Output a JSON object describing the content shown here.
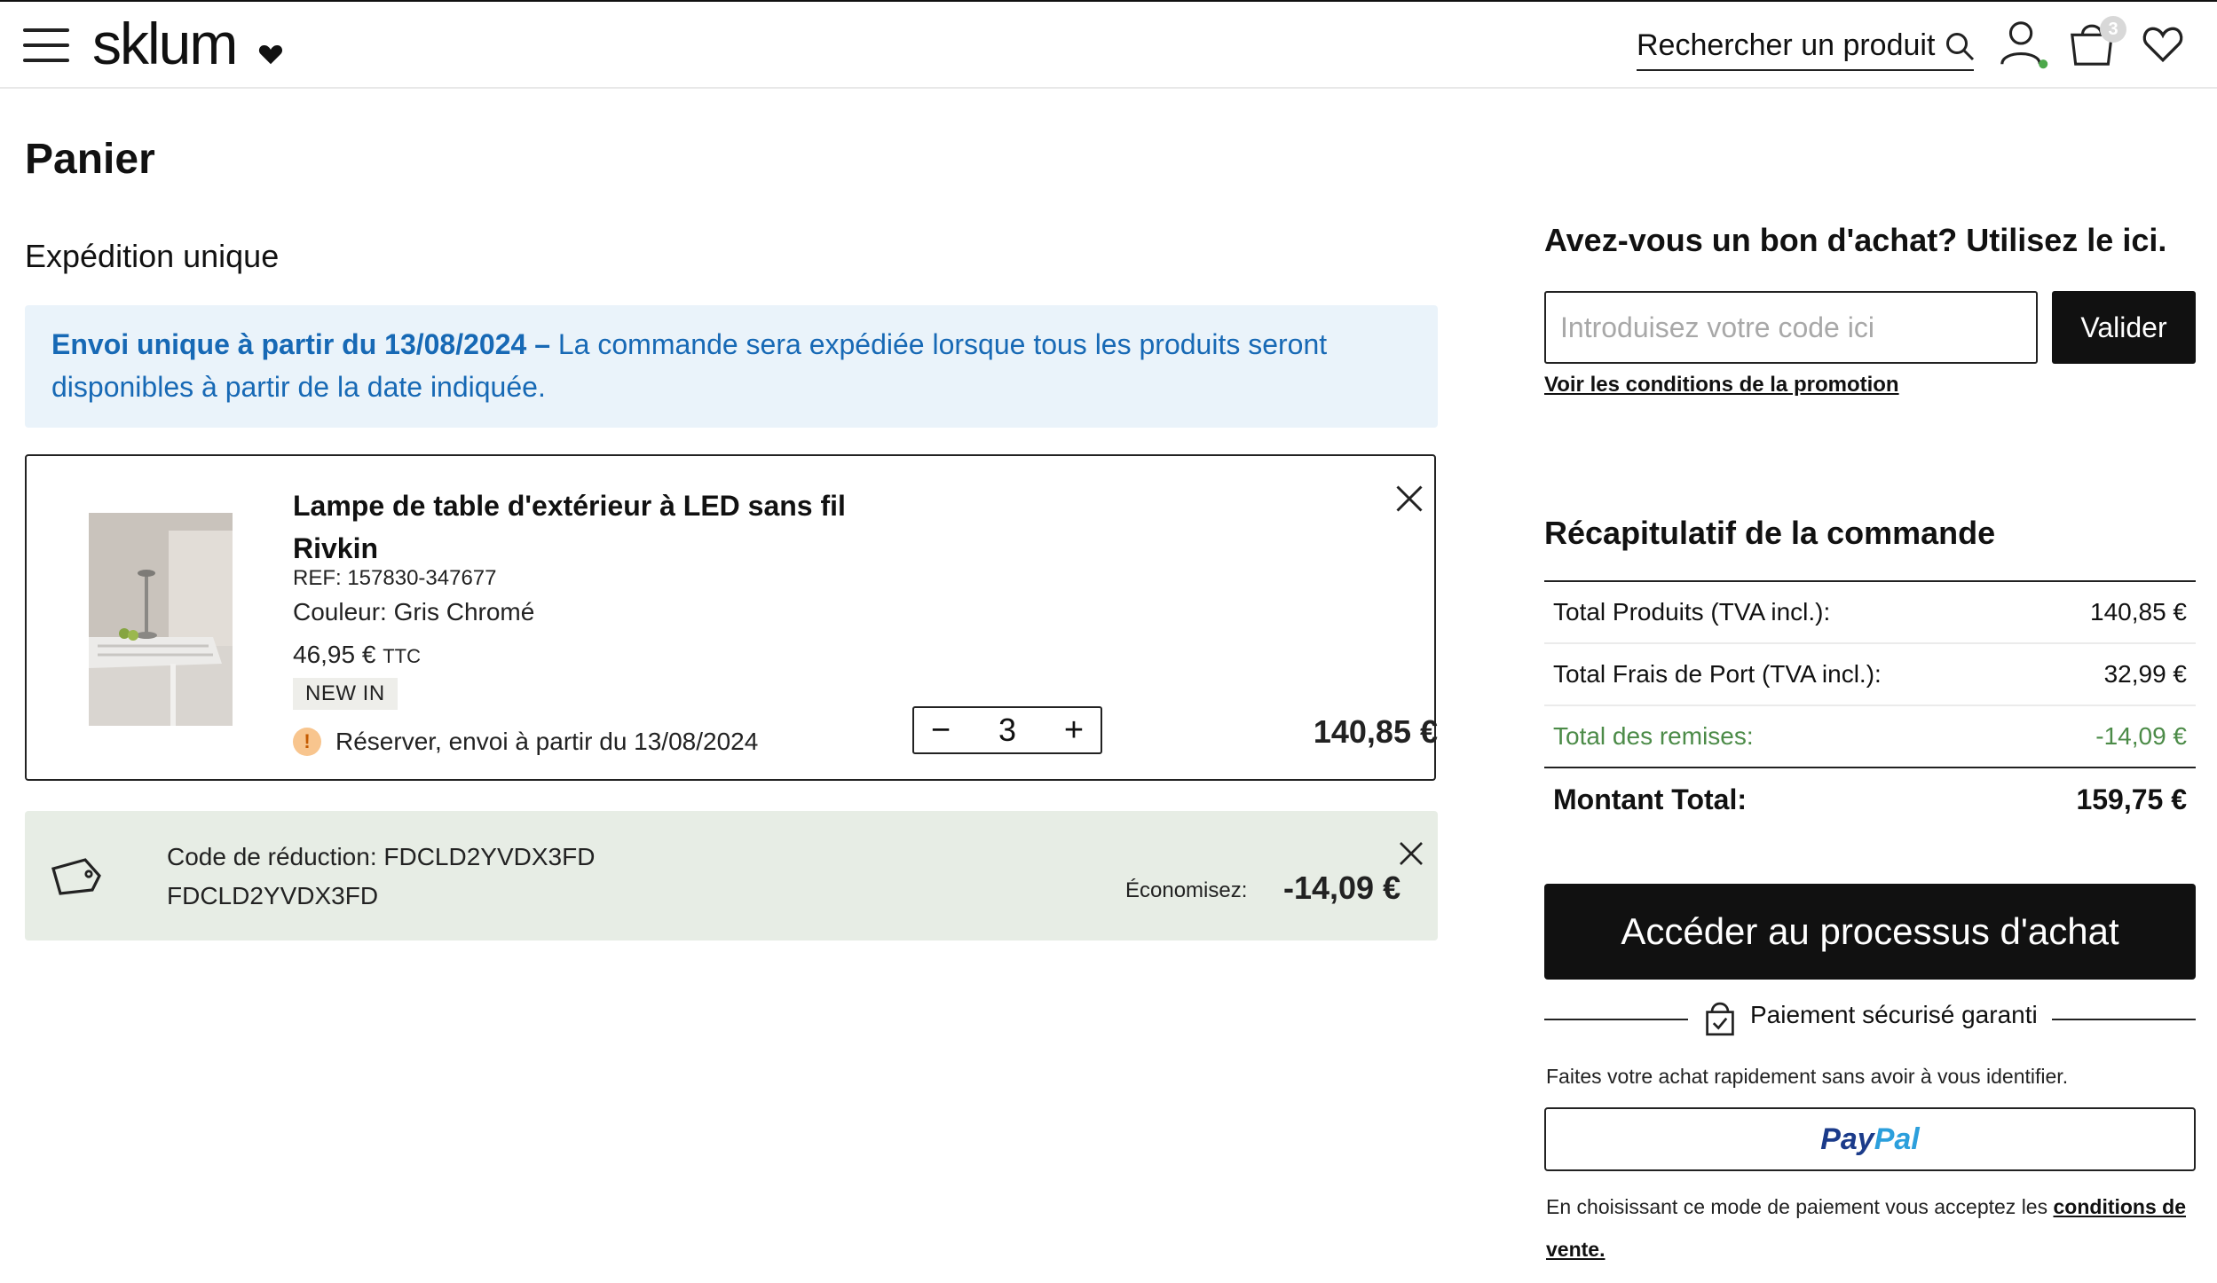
{
  "header": {
    "logo": "sklum",
    "search_label": "Rechercher un produit",
    "cart_count": "3"
  },
  "page": {
    "title": "Panier",
    "section_title": "Expédition unique"
  },
  "shipping_note": {
    "bold": "Envoi unique à partir du 13/08/2024 –",
    "text": " La commande sera expédiée lorsque tous les produits seront disponibles à partir de la date indiquée."
  },
  "product": {
    "name": "Lampe de table d'extérieur à LED sans fil Rivkin",
    "ref": "REF: 157830-347677",
    "color": "Couleur: Gris Chromé",
    "unit_price": "46,95 €",
    "unit_price_suffix": "TTC",
    "badge": "NEW IN",
    "reserve_text": "Réserver, envoi à partir du 13/08/2024",
    "quantity": "3",
    "line_total": "140,85 €"
  },
  "discount": {
    "label": "Code de réduction: FDCLD2YVDX3FD",
    "code": "FDCLD2YVDX3FD",
    "save_label": "Économisez:",
    "save_value": "-14,09 €"
  },
  "voucher": {
    "title": "Avez-vous un bon d'achat? Utilisez le ici.",
    "placeholder": "Introduisez votre code ici",
    "button": "Valider",
    "link": "Voir les conditions de la promotion"
  },
  "summary": {
    "title": "Récapitulatif de la commande",
    "rows": [
      {
        "label": "Total Produits (TVA incl.):",
        "value": "140,85 €"
      },
      {
        "label": "Total Frais de Port (TVA incl.):",
        "value": "32,99 €"
      },
      {
        "label": "Total des remises:",
        "value": "-14,09 €"
      },
      {
        "label": "Montant Total:",
        "value": "159,75 €"
      }
    ],
    "discount_color": "#4c8b48"
  },
  "checkout": {
    "button": "Accéder au processus d'achat",
    "secure": "Paiement sécurisé garanti",
    "guest": "Faites votre achat rapidement sans avoir à vous identifier.",
    "paypal_pay": "Pay",
    "paypal_pal": "Pal",
    "terms_text": "En choisissant ce mode de paiement vous acceptez les ",
    "terms_link": "conditions de vente."
  },
  "colors": {
    "accent_dark": "#111111",
    "info_bg": "#eaf3fa",
    "info_text": "#1769b5",
    "discount_bg": "#e7ede5"
  }
}
